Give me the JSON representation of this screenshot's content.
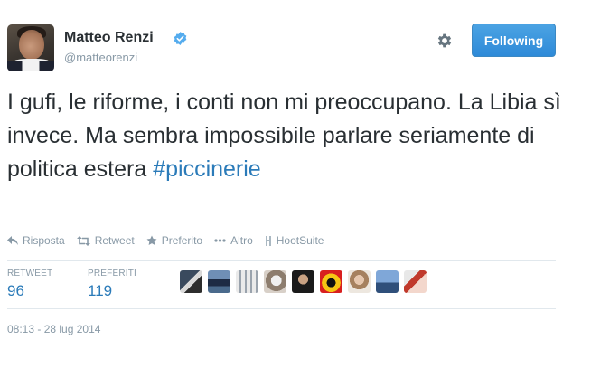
{
  "user": {
    "name": "Matteo Renzi",
    "handle": "@matteorenzi",
    "verified": true,
    "avatar_icon": "profile-photo"
  },
  "header": {
    "follow_label": "Following",
    "settings_icon": "gear-icon"
  },
  "tweet": {
    "text": "I gufi, le riforme, i conti non mi preoccupano. La Libia sì invece. Ma sembra impossibile parlare seriamente di politica estera ",
    "hashtag": "#piccinerie"
  },
  "actions": [
    {
      "label": "Risposta",
      "icon": "reply-icon"
    },
    {
      "label": "Retweet",
      "icon": "retweet-icon"
    },
    {
      "label": "Preferito",
      "icon": "star-icon"
    },
    {
      "label": "Altro",
      "icon": "more-icon"
    },
    {
      "label": "HootSuite",
      "icon": "hootsuite-icon"
    }
  ],
  "stats": {
    "retweet_label": "RETWEET",
    "retweet_count": "96",
    "favorites_label": "PREFERITI",
    "favorites_count": "119"
  },
  "favoriters_count_shown": 9,
  "timestamp": "08:13 - 28 lug 2014",
  "colors": {
    "link": "#2b7bb9",
    "muted": "#8899a6",
    "button": "#3b94d9",
    "text": "#292f33"
  }
}
